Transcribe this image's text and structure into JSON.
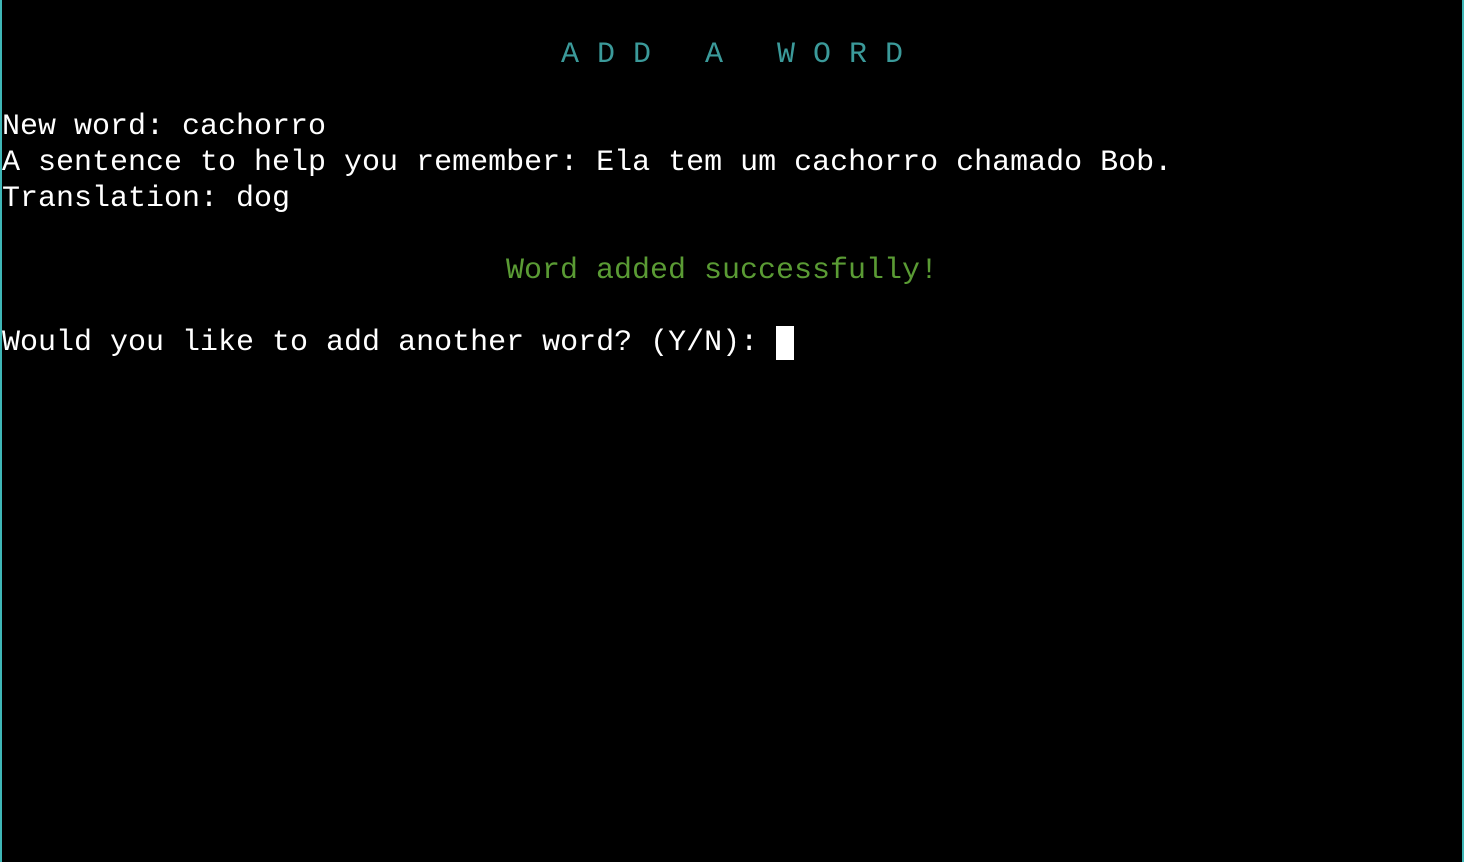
{
  "header": {
    "title": "A D D   A   W O R D"
  },
  "output": {
    "new_word_line": "New word: cachorro",
    "sentence_line": "A sentence to help you remember: Ela tem um cachorro chamado Bob.",
    "translation_line": "Translation: dog",
    "success_message": "Word added successfully!"
  },
  "prompt": {
    "text": "Would you like to add another word? (Y/N):",
    "input_value": ""
  },
  "colors": {
    "title": "#3b9a9a",
    "success": "#5a9b34",
    "border": "#3fb7b7",
    "text": "#ffffff",
    "background": "#000000"
  }
}
